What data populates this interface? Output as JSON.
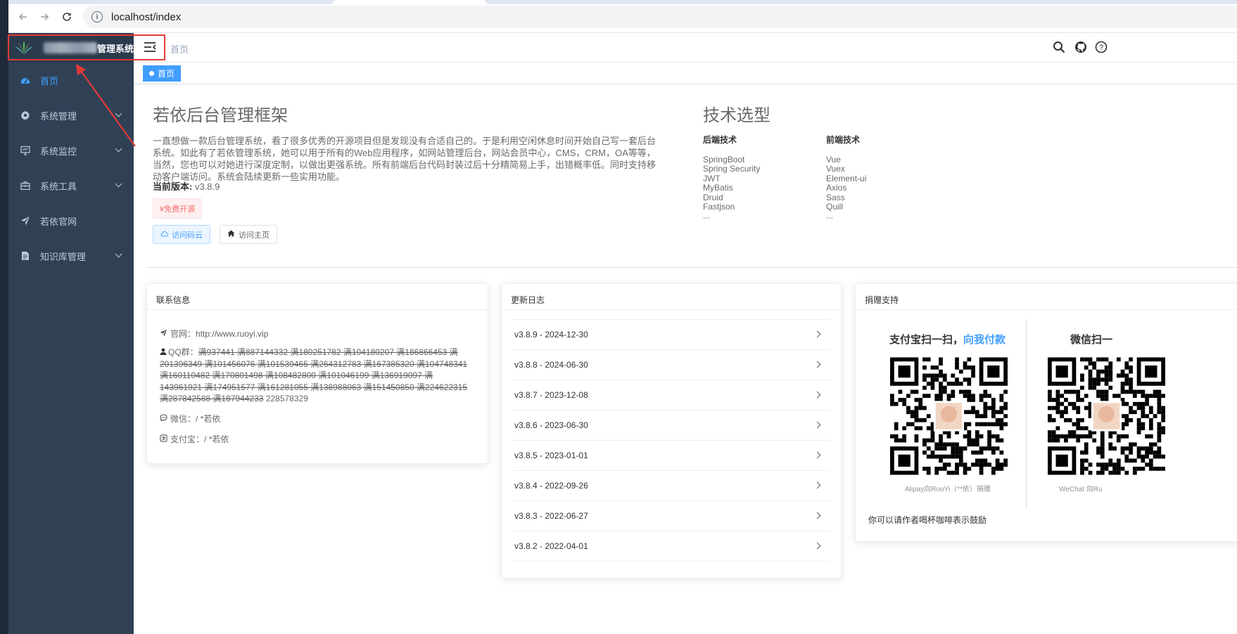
{
  "browser": {
    "url": "localhost/index"
  },
  "sidebar": {
    "logo_title": "管理系统",
    "items": [
      {
        "label": "首页",
        "icon": "dashboard-icon",
        "active": true
      },
      {
        "label": "系统管理",
        "icon": "gear-icon",
        "has_children": true
      },
      {
        "label": "系统监控",
        "icon": "monitor-icon",
        "has_children": true
      },
      {
        "label": "系统工具",
        "icon": "toolbox-icon",
        "has_children": true
      },
      {
        "label": "若依官网",
        "icon": "send-icon"
      },
      {
        "label": "知识库管理",
        "icon": "document-icon",
        "has_children": true
      }
    ]
  },
  "navbar": {
    "breadcrumb": "首页",
    "icons": [
      "search-icon",
      "github-icon",
      "help-icon"
    ]
  },
  "tags_view": {
    "active_tag": "首页"
  },
  "intro": {
    "title": "若依后台管理框架",
    "description": "一直想做一款后台管理系统，看了很多优秀的开源项目但是发现没有合适自己的。于是利用空闲休息时间开始自己写一套后台系统。如此有了若依管理系统，她可以用于所有的Web应用程序，如网站管理后台，网站会员中心，CMS，CRM，OA等等，当然，您也可以对她进行深度定制，以做出更强系统。所有前端后台代码封装过后十分精简易上手，出错概率低。同时支持移动客户端访问。系统会陆续更新一些实用功能。",
    "version_label": "当前版本:",
    "version_value": "v3.8.9",
    "free_tag": "¥免费开源",
    "btn_gitee": "访问码云",
    "btn_home": "访问主页"
  },
  "tech": {
    "title": "技术选型",
    "backend_title": "后端技术",
    "backend": [
      "SpringBoot",
      "Spring Security",
      "JWT",
      "MyBatis",
      "Druid",
      "Fastjson",
      "..."
    ],
    "frontend_title": "前端技术",
    "frontend": [
      "Vue",
      "Vuex",
      "Element-ui",
      "Axios",
      "Sass",
      "Quill",
      "..."
    ]
  },
  "contact": {
    "header": "联系信息",
    "website_label": "官网：",
    "website_value": "http://www.ruoyi.vip",
    "qq_label": "QQ群：",
    "qq_struck": "满937441 满887144332 满180251782 满104180207 满186866453 满201396349 满101456076 满101539465 满264312783 满167385320 满104748341 满160110482 满170801498 满108482800 满101046199 满136919097 满143961921 满174951577 满161281055 满138988063 满151450850 满224622315 满287842588 满187944233",
    "qq_current": "228578329",
    "wechat": "微信：/ *若依",
    "alipay": "支付宝：/ *若依"
  },
  "changelog": {
    "header": "更新日志",
    "items": [
      "v3.8.9 - 2024-12-30",
      "v3.8.8 - 2024-06-30",
      "v3.8.7 - 2023-12-08",
      "v3.8.6 - 2023-06-30",
      "v3.8.5 - 2023-01-01",
      "v3.8.4 - 2022-09-26",
      "v3.8.3 - 2022-06-27",
      "v3.8.2 - 2022-04-01"
    ]
  },
  "donate": {
    "header": "捐赠支持",
    "alipay_title_prefix": "支付宝扫一扫，",
    "alipay_title_link": "向我付款",
    "alipay_caption": "Alipay向RuoYi（**依）捐赠",
    "wechat_title": "微信扫一",
    "wechat_caption": "WeChat 向Ru",
    "footer": "你可以请作者喝杯咖啡表示鼓励"
  },
  "colors": {
    "sidebar_bg": "#304156",
    "accent": "#409eff",
    "annotation_red": "#e53935"
  }
}
